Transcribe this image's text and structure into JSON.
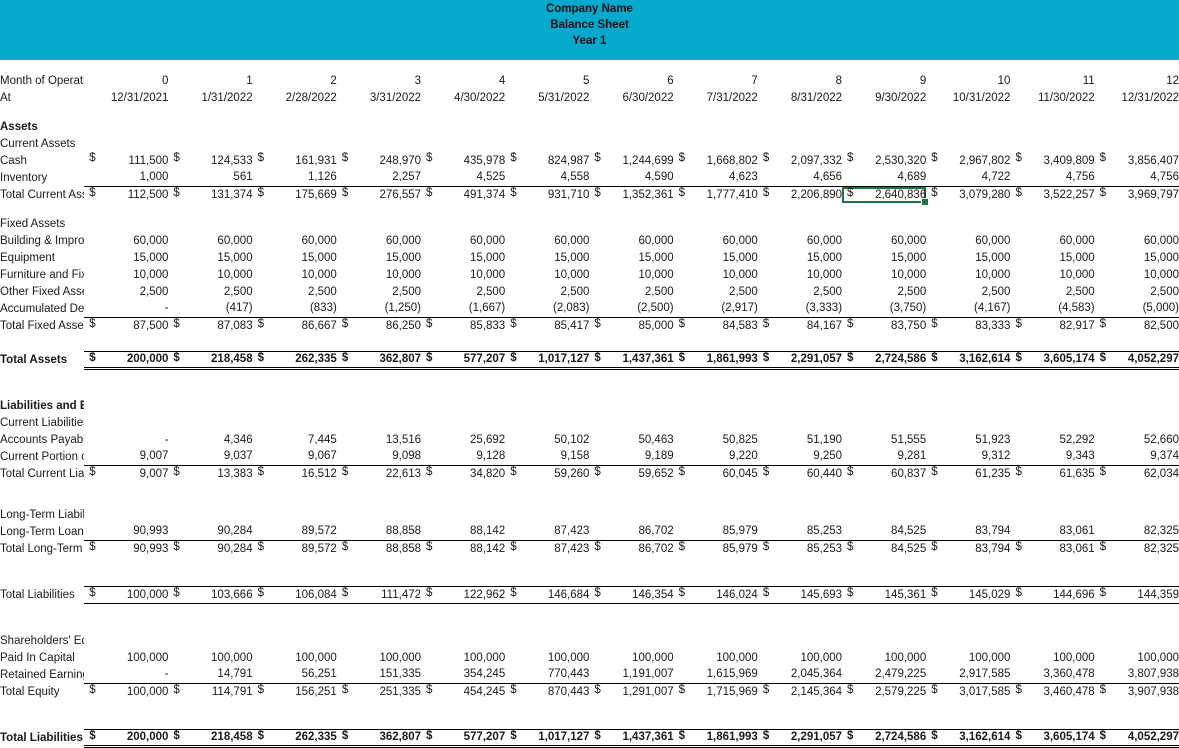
{
  "banner": {
    "company": "Company Name",
    "statement": "Balance Sheet",
    "period": "Year 1",
    "color": "#06A9CE"
  },
  "selection": {
    "cell_value": "$ 2,640,836",
    "row": "Total Current Assets",
    "column": "9/30/2022",
    "border_color": "#217346"
  },
  "header": {
    "month_label": "Month of Operation:",
    "at_label": "At",
    "months": [
      "0",
      "1",
      "2",
      "3",
      "4",
      "5",
      "6",
      "7",
      "8",
      "9",
      "10",
      "11",
      "12"
    ],
    "dates": [
      "12/31/2021",
      "1/31/2022",
      "2/28/2022",
      "3/31/2022",
      "4/30/2022",
      "5/31/2022",
      "6/30/2022",
      "7/31/2022",
      "8/31/2022",
      "9/30/2022",
      "10/31/2022",
      "11/30/2022",
      "12/31/2022"
    ]
  },
  "sections": {
    "assets_title": "Assets",
    "current_assets_title": "Current Assets",
    "fixed_assets_title": "Fixed Assets",
    "total_assets_title": "Total Assets",
    "liabilities_equity_title": "Liabilities and Equity",
    "current_liabilities_title": "Current Liabilities",
    "long_term_liabilities_title": "Long-Term Liabilities",
    "total_liabilities_title": "Total Liabilities",
    "shareholders_equity_title": "Shareholders' Equity",
    "total_equity_title": "Total Equity",
    "total_liabilities_equity_title": "Total Liabilities and Equity"
  },
  "rows": {
    "cash": {
      "label": "Cash",
      "values": [
        "111,500",
        "124,533",
        "161,931",
        "248,970",
        "435,978",
        "824,987",
        "1,244,699",
        "1,668,802",
        "2,097,332",
        "2,530,320",
        "2,967,802",
        "3,409,809",
        "3,856,407"
      ]
    },
    "inventory": {
      "label": "Inventory",
      "values": [
        "1,000",
        "561",
        "1,126",
        "2,257",
        "4,525",
        "4,558",
        "4,590",
        "4,623",
        "4,656",
        "4,689",
        "4,722",
        "4,756",
        "4,756"
      ]
    },
    "total_current_assets": {
      "label": "Total Current Assets",
      "values": [
        "112,500",
        "131,374",
        "175,669",
        "276,557",
        "491,374",
        "931,710",
        "1,352,361",
        "1,777,410",
        "2,206,890",
        "2,640,836",
        "3,079,280",
        "3,522,257",
        "3,969,797"
      ]
    },
    "building": {
      "label": "Building & Improvements",
      "values": [
        "60,000",
        "60,000",
        "60,000",
        "60,000",
        "60,000",
        "60,000",
        "60,000",
        "60,000",
        "60,000",
        "60,000",
        "60,000",
        "60,000",
        "60,000"
      ]
    },
    "equipment": {
      "label": "Equipment",
      "values": [
        "15,000",
        "15,000",
        "15,000",
        "15,000",
        "15,000",
        "15,000",
        "15,000",
        "15,000",
        "15,000",
        "15,000",
        "15,000",
        "15,000",
        "15,000"
      ]
    },
    "furniture": {
      "label": "Furniture and Fixtures",
      "values": [
        "10,000",
        "10,000",
        "10,000",
        "10,000",
        "10,000",
        "10,000",
        "10,000",
        "10,000",
        "10,000",
        "10,000",
        "10,000",
        "10,000",
        "10,000"
      ]
    },
    "other_fixed_assets": {
      "label": "Other Fixed Assets",
      "values": [
        "2,500",
        "2,500",
        "2,500",
        "2,500",
        "2,500",
        "2,500",
        "2,500",
        "2,500",
        "2,500",
        "2,500",
        "2,500",
        "2,500",
        "2,500"
      ]
    },
    "accumulated_depreciation": {
      "label": "Accumulated Depreciation",
      "values": [
        "-",
        "(417)",
        "(833)",
        "(1,250)",
        "(1,667)",
        "(2,083)",
        "(2,500)",
        "(2,917)",
        "(3,333)",
        "(3,750)",
        "(4,167)",
        "(4,583)",
        "(5,000)"
      ]
    },
    "total_fixed_assets_net": {
      "label": "Total Fixed Assets Net",
      "values": [
        "87,500",
        "87,083",
        "86,667",
        "86,250",
        "85,833",
        "85,417",
        "85,000",
        "84,583",
        "84,167",
        "83,750",
        "83,333",
        "82,917",
        "82,500"
      ]
    },
    "total_assets": {
      "label": "Total Assets",
      "values": [
        "200,000",
        "218,458",
        "262,335",
        "362,807",
        "577,207",
        "1,017,127",
        "1,437,361",
        "1,861,993",
        "2,291,057",
        "2,724,586",
        "3,162,614",
        "3,605,174",
        "4,052,297"
      ]
    },
    "accounts_payable": {
      "label": "Accounts Payable",
      "values": [
        "-",
        "4,346",
        "7,445",
        "13,516",
        "25,692",
        "50,102",
        "50,463",
        "50,825",
        "51,190",
        "51,555",
        "51,923",
        "52,292",
        "52,660"
      ]
    },
    "current_portion_loans": {
      "label": "Current Portion of Long Term Loans",
      "values": [
        "9,007",
        "9,037",
        "9,067",
        "9,098",
        "9,128",
        "9,158",
        "9,189",
        "9,220",
        "9,250",
        "9,281",
        "9,312",
        "9,343",
        "9,374"
      ]
    },
    "total_current_liabilities": {
      "label": "Total Current Liabilities",
      "values": [
        "9,007",
        "13,383",
        "16,512",
        "22,613",
        "34,820",
        "59,260",
        "59,652",
        "60,045",
        "60,440",
        "60,837",
        "61,235",
        "61,635",
        "62,034"
      ]
    },
    "long_term_loans": {
      "label": "Long-Term Loans",
      "values": [
        "90,993",
        "90,284",
        "89,572",
        "88,858",
        "88,142",
        "87,423",
        "86,702",
        "85,979",
        "85,253",
        "84,525",
        "83,794",
        "83,061",
        "82,325"
      ]
    },
    "total_long_term_liabilities": {
      "label": "Total Long-Term Liabilities",
      "values": [
        "90,993",
        "90,284",
        "89,572",
        "88,858",
        "88,142",
        "87,423",
        "86,702",
        "85,979",
        "85,253",
        "84,525",
        "83,794",
        "83,061",
        "82,325"
      ]
    },
    "total_liabilities": {
      "label": "Total Liabilities",
      "values": [
        "100,000",
        "103,666",
        "106,084",
        "111,472",
        "122,962",
        "146,684",
        "146,354",
        "146,024",
        "145,693",
        "145,361",
        "145,029",
        "144,696",
        "144,359"
      ]
    },
    "paid_in_capital": {
      "label": "Paid In Capital",
      "values": [
        "100,000",
        "100,000",
        "100,000",
        "100,000",
        "100,000",
        "100,000",
        "100,000",
        "100,000",
        "100,000",
        "100,000",
        "100,000",
        "100,000",
        "100,000"
      ]
    },
    "retained_earnings": {
      "label": "Retained Earnings",
      "values": [
        "-",
        "14,791",
        "56,251",
        "151,335",
        "354,245",
        "770,443",
        "1,191,007",
        "1,615,969",
        "2,045,364",
        "2,479,225",
        "2,917,585",
        "3,360,478",
        "3,807,938"
      ]
    },
    "total_equity": {
      "label": "Total Equity",
      "values": [
        "100,000",
        "114,791",
        "156,251",
        "251,335",
        "454,245",
        "870,443",
        "1,291,007",
        "1,715,969",
        "2,145,364",
        "2,579,225",
        "3,017,585",
        "3,460,478",
        "3,907,938"
      ]
    },
    "total_liabilities_and_equity": {
      "label": "Total Liabilities and Equity",
      "values": [
        "200,000",
        "218,458",
        "262,335",
        "362,807",
        "577,207",
        "1,017,127",
        "1,437,361",
        "1,861,993",
        "2,291,057",
        "2,724,586",
        "3,162,614",
        "3,605,174",
        "4,052,297"
      ]
    }
  }
}
